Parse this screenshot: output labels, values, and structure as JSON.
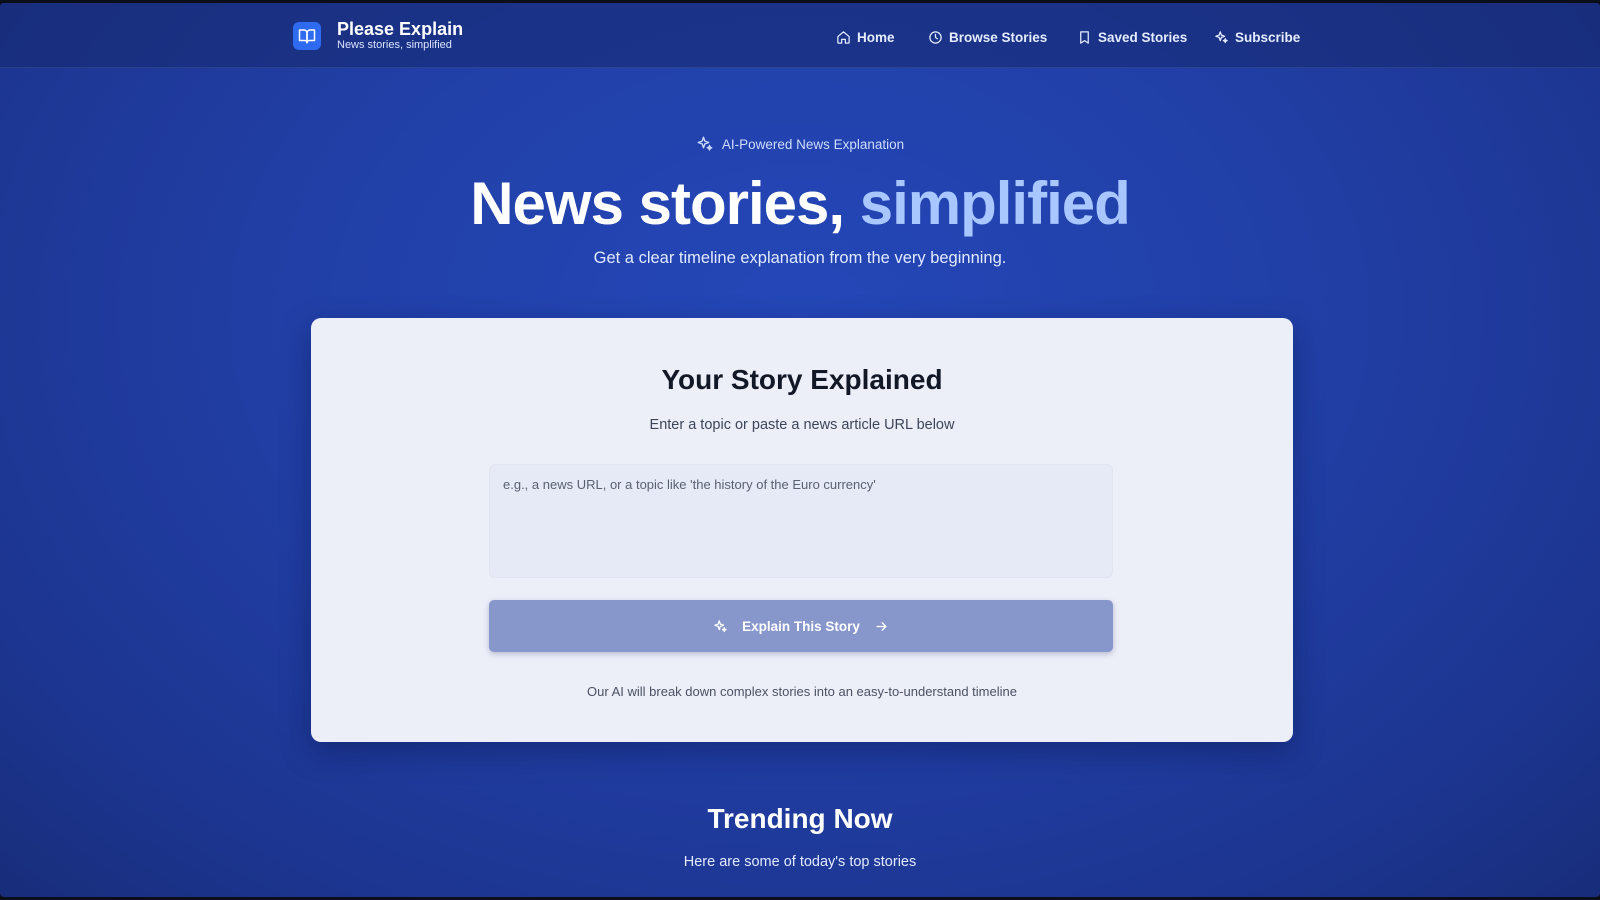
{
  "brand": {
    "title": "Please Explain",
    "subtitle": "News stories, simplified",
    "logo_icon": "book-open-icon"
  },
  "nav": {
    "items": [
      {
        "label": "Home",
        "icon": "home-icon"
      },
      {
        "label": "Browse Stories",
        "icon": "clock-icon"
      },
      {
        "label": "Saved Stories",
        "icon": "bookmark-icon"
      },
      {
        "label": "Subscribe",
        "icon": "sparkles-icon"
      }
    ]
  },
  "hero": {
    "badge": "AI-Powered News Explanation",
    "title_main": "News stories, ",
    "title_accent": "simplified",
    "subtitle": "Get a clear timeline explanation from the very beginning."
  },
  "card": {
    "title": "Your Story Explained",
    "subtitle": "Enter a topic or paste a news article URL below",
    "input_value": "",
    "input_placeholder": "e.g., a news URL, or a topic like 'the history of the Euro currency'",
    "button_label": "Explain This Story",
    "note": "Our AI will break down complex stories into an easy-to-understand timeline"
  },
  "trending": {
    "title": "Trending Now",
    "subtitle": "Here are some of today's top stories"
  },
  "colors": {
    "background": "#213fa6",
    "accent_text": "#a8c6ff",
    "logo_bg": "#2f6bf0",
    "card_bg": "#eceef8",
    "button_bg": "#8797cc"
  }
}
